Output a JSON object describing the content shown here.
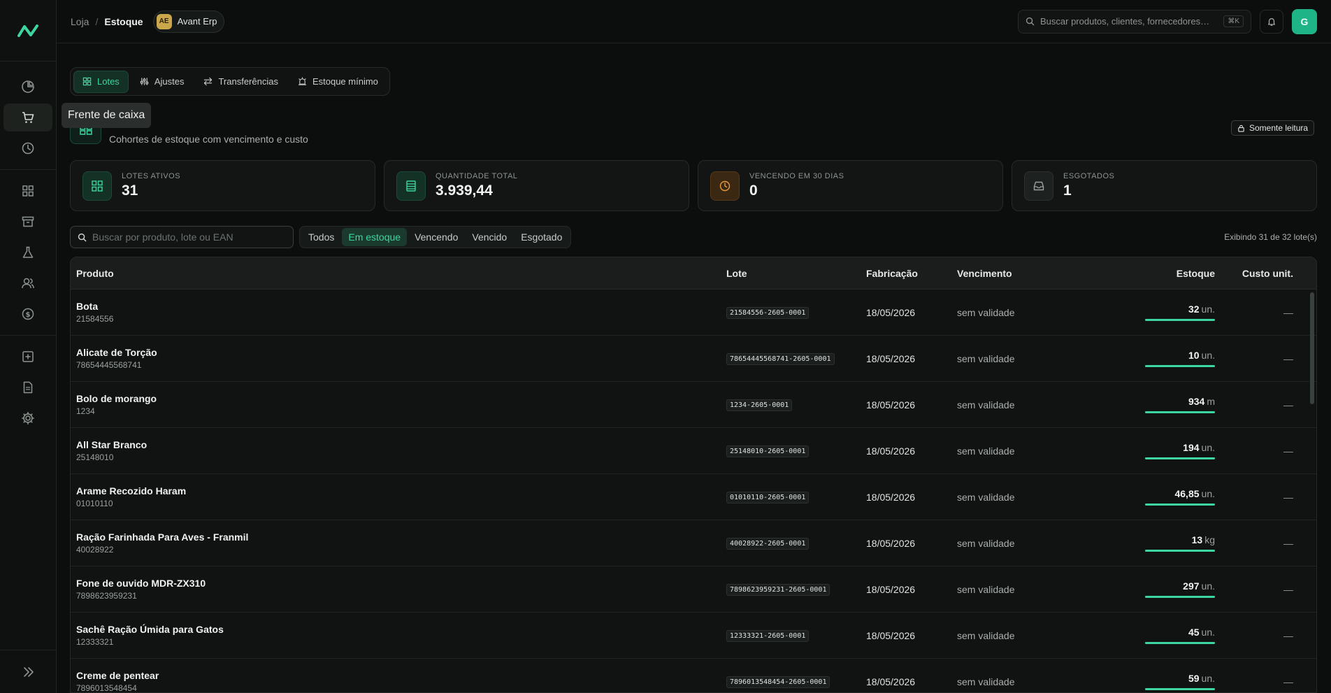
{
  "header": {
    "breadcrumb_root": "Loja",
    "breadcrumb_current": "Estoque",
    "org_initials": "AE",
    "org_name": "Avant Erp",
    "search_placeholder": "Buscar produtos, clientes, fornecedores…",
    "search_shortcut": "⌘K",
    "user_initial": "G"
  },
  "sidebar": {
    "tooltip": "Frente de caixa",
    "icons": [
      "chart-pie-icon",
      "cart-icon",
      "history-icon",
      "grid-icon",
      "archive-icon",
      "flask-icon",
      "users-icon",
      "dollar-icon",
      "plus-square-icon",
      "document-icon",
      "gear-icon"
    ],
    "collapse_icon": "chevrons-right-icon"
  },
  "tabs": [
    {
      "label": "Lotes",
      "icon": "grid-icon",
      "active": true
    },
    {
      "label": "Ajustes",
      "icon": "sliders-icon",
      "active": false
    },
    {
      "label": "Transferências",
      "icon": "arrows-icon",
      "active": false
    },
    {
      "label": "Estoque mínimo",
      "icon": "alarm-icon",
      "active": false
    }
  ],
  "page": {
    "subtitle": "Cohortes de estoque com vencimento e custo",
    "readonly_label": "Somente leitura"
  },
  "stats": [
    {
      "label": "LOTES ATIVOS",
      "value": "31",
      "tone": "green"
    },
    {
      "label": "QUANTIDADE TOTAL",
      "value": "3.939,44",
      "tone": "green"
    },
    {
      "label": "VENCENDO EM 30 DIAS",
      "value": "0",
      "tone": "orange"
    },
    {
      "label": "ESGOTADOS",
      "value": "1",
      "tone": "gray"
    }
  ],
  "filters": {
    "search_placeholder": "Buscar por produto, lote ou EAN",
    "segments": [
      {
        "label": "Todos",
        "active": false
      },
      {
        "label": "Em estoque",
        "active": true
      },
      {
        "label": "Vencendo",
        "active": false
      },
      {
        "label": "Vencido",
        "active": false
      },
      {
        "label": "Esgotado",
        "active": false
      }
    ],
    "showing": "Exibindo 31 de 32 lote(s)"
  },
  "table": {
    "columns": {
      "produto": "Produto",
      "lote": "Lote",
      "fabricacao": "Fabricação",
      "vencimento": "Vencimento",
      "estoque": "Estoque",
      "custo": "Custo unit."
    },
    "rows": [
      {
        "name": "Bota",
        "code": "21584556",
        "lote": "21584556-2605-0001",
        "fab": "18/05/2026",
        "venc": "sem validade",
        "stock": "32",
        "unit": "un.",
        "cost": "—"
      },
      {
        "name": "Alicate de Torção",
        "code": "78654445568741",
        "lote": "78654445568741-2605-0001",
        "fab": "18/05/2026",
        "venc": "sem validade",
        "stock": "10",
        "unit": "un.",
        "cost": "—"
      },
      {
        "name": "Bolo de morango",
        "code": "1234",
        "lote": "1234-2605-0001",
        "fab": "18/05/2026",
        "venc": "sem validade",
        "stock": "934",
        "unit": "m",
        "cost": "—"
      },
      {
        "name": "All Star Branco",
        "code": "25148010",
        "lote": "25148010-2605-0001",
        "fab": "18/05/2026",
        "venc": "sem validade",
        "stock": "194",
        "unit": "un.",
        "cost": "—"
      },
      {
        "name": "Arame Recozido Haram",
        "code": "01010110",
        "lote": "01010110-2605-0001",
        "fab": "18/05/2026",
        "venc": "sem validade",
        "stock": "46,85",
        "unit": "un.",
        "cost": "—"
      },
      {
        "name": "Ração Farinhada Para Aves - Franmil",
        "code": "40028922",
        "lote": "40028922-2605-0001",
        "fab": "18/05/2026",
        "venc": "sem validade",
        "stock": "13",
        "unit": "kg",
        "cost": "—"
      },
      {
        "name": "Fone de ouvido MDR-ZX310",
        "code": "7898623959231",
        "lote": "7898623959231-2605-0001",
        "fab": "18/05/2026",
        "venc": "sem validade",
        "stock": "297",
        "unit": "un.",
        "cost": "—"
      },
      {
        "name": "Sachê Ração Úmida para Gatos",
        "code": "12333321",
        "lote": "12333321-2605-0001",
        "fab": "18/05/2026",
        "venc": "sem validade",
        "stock": "45",
        "unit": "un.",
        "cost": "—"
      },
      {
        "name": "Creme de pentear",
        "code": "7896013548454",
        "lote": "7896013548454-2605-0001",
        "fab": "18/05/2026",
        "venc": "sem validade",
        "stock": "59",
        "unit": "un.",
        "cost": "—"
      }
    ]
  },
  "colors": {
    "accent": "#3dd6a0",
    "warning": "#e99a3c",
    "background": "#0c0e0d"
  }
}
